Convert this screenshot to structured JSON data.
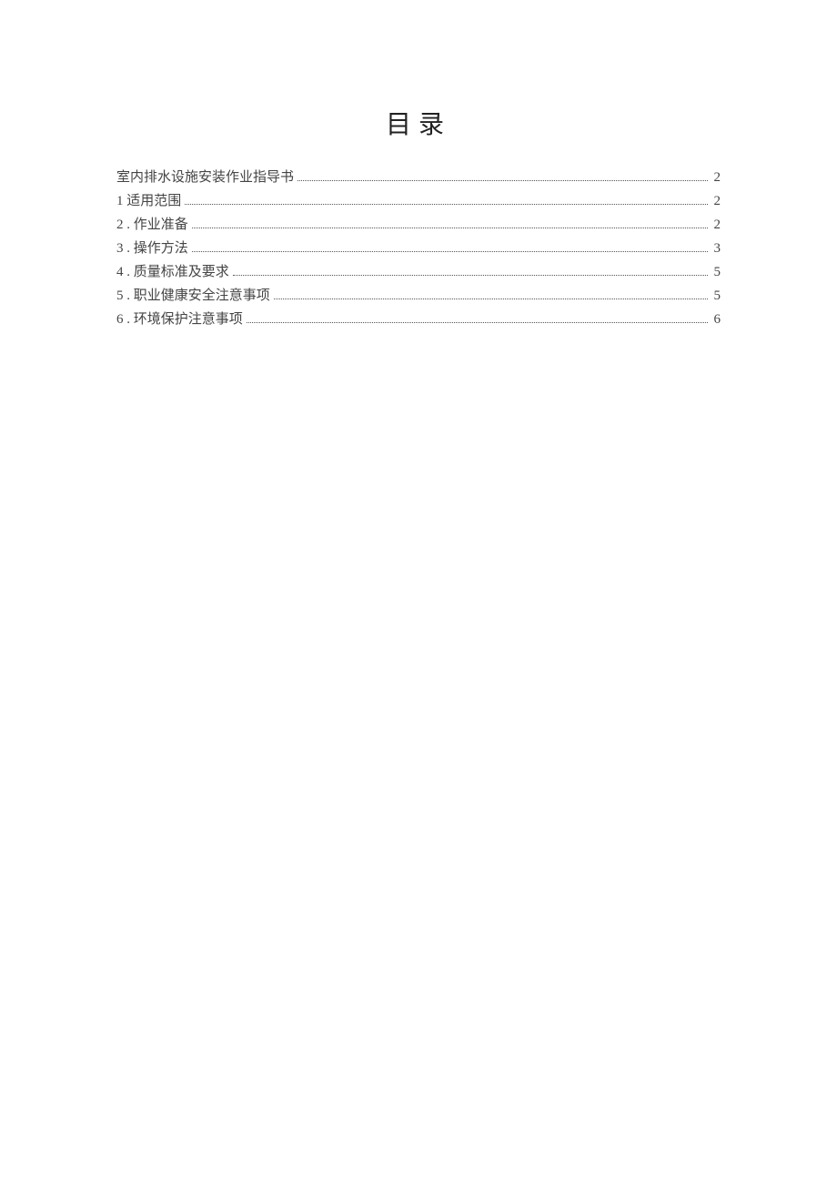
{
  "title": "目录",
  "toc": {
    "entries": [
      {
        "label": "室内排水设施安装作业指导书",
        "page": "2"
      },
      {
        "label": "1 适用范围",
        "page": "2"
      },
      {
        "label": "2  . 作业准备",
        "page": "2"
      },
      {
        "label": "3  . 操作方法",
        "page": "3"
      },
      {
        "label": "4  . 质量标准及要求",
        "page": "5"
      },
      {
        "label": "5  . 职业健康安全注意事项",
        "page": "5"
      },
      {
        "label": "6  . 环境保护注意事项",
        "page": "6"
      }
    ]
  }
}
